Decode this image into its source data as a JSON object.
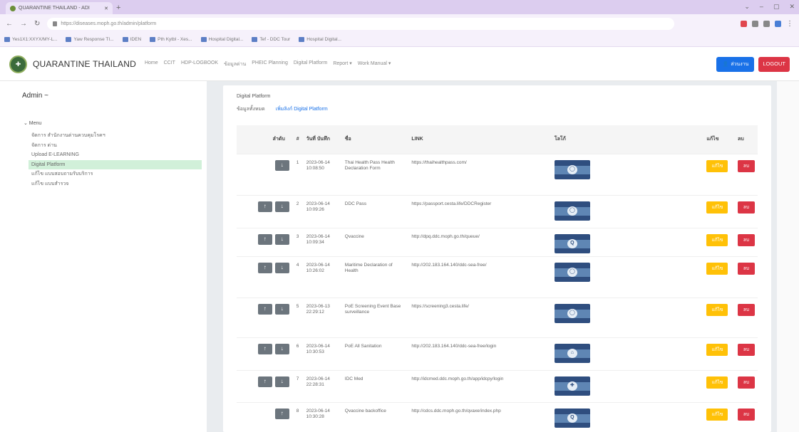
{
  "browser": {
    "tab_title": "QUARANTINE THAILAND - ADI",
    "new_tab": "+",
    "url": "https://diseases.moph.go.th/admin/platform",
    "bookmarks": [
      "Yes1X1:XXYX/MY-L...",
      "Yaw Response TI...",
      "IDEN",
      "Pth Kytbl - Xes...",
      "Hospital Digital...",
      "Tef - DDC Tour",
      "Hospital Digital..."
    ]
  },
  "header": {
    "brand": "QUARANTINE THAILAND",
    "nav": [
      "Home",
      "CCIT",
      "HDP-LOGBOOK",
      "ข้อมูลด่าน",
      "PHEIC Planning",
      "Digital Platform",
      "Report ▾",
      "Work Manual ▾"
    ],
    "user_button": "ส่วนงาน",
    "logout_button": "LOGOUT"
  },
  "sidebar": {
    "admin_label": "Admin ~",
    "menu_heading": "⌄ Menu",
    "items": [
      {
        "label": "จัดการ สำนักงานด่านควบคุมโรคฯ",
        "active": false
      },
      {
        "label": "จัดการ ด่าน",
        "active": false
      },
      {
        "label": "Upload E-LEARNING",
        "active": false
      },
      {
        "label": "Digital Platform",
        "active": true
      },
      {
        "label": "แก้ไข แบบสอบถามรับบริการ",
        "active": false
      },
      {
        "label": "แก้ไข แบบสำรวจ",
        "active": false
      }
    ]
  },
  "main": {
    "title": "Digital Platform",
    "tabs": [
      "ข้อมูลทั้งหมด",
      "เพิ่มลิงก์ Digital Platform"
    ],
    "table": {
      "headers": {
        "order": "ลำดับ",
        "no": "#",
        "date": "วันที่ บันทึก",
        "name": "ชื่อ",
        "link": "LINK",
        "image": "โลโก้",
        "edit": "แก้ไข",
        "delete": "ลบ"
      },
      "edit_label": "แก้ไข",
      "delete_label": "ลบ",
      "rows": [
        {
          "no": "1",
          "date": "2023-06-14 10:08:50",
          "name": "Thai Health Pass Health Declaration Form",
          "link": "https://thaihealthpass.com/",
          "order_buttons": 1,
          "icon": "◯"
        },
        {
          "no": "2",
          "date": "2023-06-14 10:09:26",
          "name": "DDC Pass",
          "link": "https://passport.cesta.life/DDCRegister",
          "order_buttons": 2,
          "icon": "◯"
        },
        {
          "no": "3",
          "date": "2023-06-14 10:09:34",
          "name": "Qvaccine",
          "link": "http://dpq.ddc.moph.go.th/queue/",
          "order_buttons": 2,
          "icon": "Q"
        },
        {
          "no": "4",
          "date": "2023-06-14 10:26:02",
          "name": "Maritime Declaration of Health",
          "link": "http://202.183.164.140/ddc-sea-free/",
          "order_buttons": 2,
          "icon": "◯"
        },
        {
          "no": "5",
          "date": "2023-06-13 22:29:12",
          "name": "PoE Screening Event Base surveillance",
          "link": "https://screening3.cesta.life/",
          "order_buttons": 2,
          "icon": "◯"
        },
        {
          "no": "6",
          "date": "2023-06-14 10:30:53",
          "name": "PoE All Sanitation",
          "link": "http://202.183.164.140/ddc-sea-free/login",
          "order_buttons": 2,
          "icon": "⌂"
        },
        {
          "no": "7",
          "date": "2023-06-14 22:28:31",
          "name": "IDC Med",
          "link": "http://idcmed.ddc.moph.go.th/app/idcpy/login",
          "order_buttons": 2,
          "icon": "✚"
        },
        {
          "no": "8",
          "date": "2023-06-14 10:30:28",
          "name": "Qvaccine backoffice",
          "link": "http://cdcs.ddc.moph.go.th/qvaxe/index.php",
          "order_buttons": 1,
          "icon": "Q"
        }
      ]
    }
  }
}
